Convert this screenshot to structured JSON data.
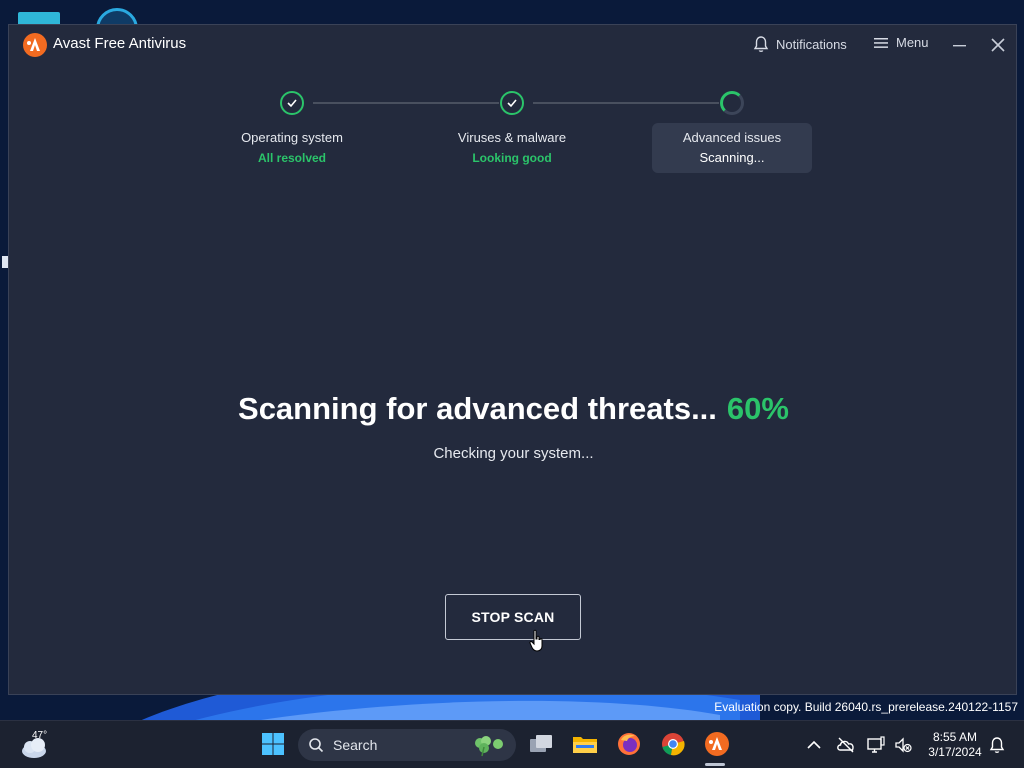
{
  "window": {
    "title": "Avast Free Antivirus",
    "notifications_label": "Notifications",
    "menu_label": "Menu"
  },
  "steps": [
    {
      "name": "Operating system",
      "status": "All resolved",
      "state": "done"
    },
    {
      "name": "Viruses & malware",
      "status": "Looking good",
      "state": "done"
    },
    {
      "name": "Advanced issues",
      "status": "Scanning...",
      "state": "in-progress"
    }
  ],
  "scan": {
    "headline": "Scanning for advanced threats...",
    "percent": "60%",
    "progress_fraction": 0.6,
    "subtext": "Checking your system...",
    "stop_label": "STOP SCAN"
  },
  "watermark": "Evaluation copy. Build 26040.rs_prerelease.240122-1157",
  "taskbar": {
    "weather_temp": "47°",
    "search_label": "Search",
    "apps": [
      "windows-start-icon",
      "task-view-icon",
      "file-explorer-icon",
      "firefox-icon",
      "chrome-icon",
      "avast-icon"
    ],
    "clock_time": "8:55 AM",
    "clock_date": "3/17/2024"
  },
  "colors": {
    "accent_green": "#2bc46a",
    "window_bg": "#232a3d",
    "avast_orange": "#f26b21"
  }
}
